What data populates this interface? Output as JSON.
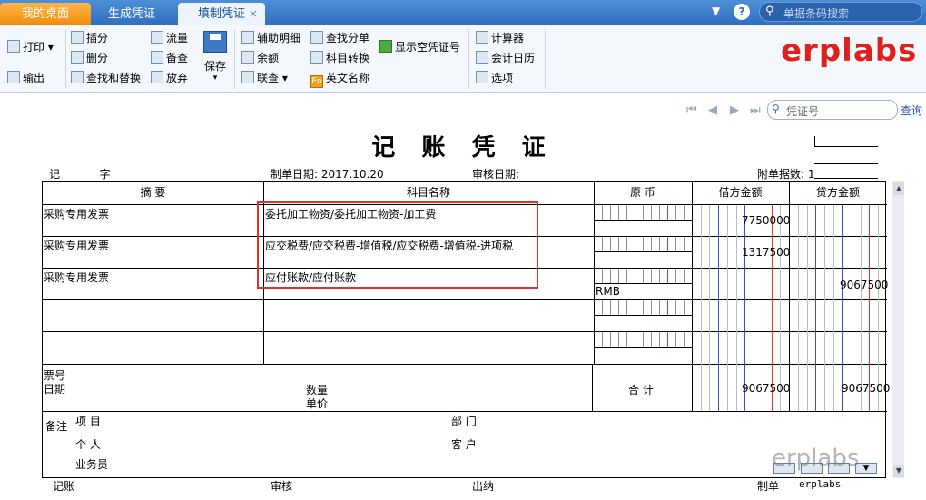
{
  "tabs": {
    "home": "我的桌面",
    "generate": "生成凭证",
    "fill": "填制凭证",
    "close": "×"
  },
  "top_search": {
    "placeholder": "单据条码搜索"
  },
  "brand": "erplabs",
  "ribbon": {
    "print": "打印",
    "output": "输出",
    "insert": "插分",
    "delete": "删分",
    "find_replace": "查找和替换",
    "flow": "流量",
    "backup": "备查",
    "discard": "放弃",
    "save": "保存",
    "aux_detail": "辅助明细",
    "balance": "余额",
    "linked_query": "联查",
    "find_entry": "查找分单",
    "account_convert": "科目转换",
    "english_name": "英文名称",
    "show_empty_no": "显示空凭证号",
    "calculator": "计算器",
    "calendar": "会计日历",
    "options": "选项"
  },
  "voucher_nav": {
    "search_placeholder": "凭证号",
    "query": "查询"
  },
  "voucher": {
    "title": "记 账 凭 证",
    "type_label": "记",
    "number_label": "字",
    "date_label": "制单日期:",
    "date": "2017.10.20",
    "audit_date_label": "审核日期:",
    "attachments_label": "附单据数:",
    "attachments": "1",
    "headers": {
      "summary": "摘 要",
      "account": "科目名称",
      "currency": "原 币",
      "debit": "借方金额",
      "credit": "贷方金额"
    },
    "rows": [
      {
        "summary": "采购专用发票",
        "account": "委托加工物资/委托加工物资-加工费",
        "currency": "",
        "debit": "7750000",
        "credit": ""
      },
      {
        "summary": "采购专用发票",
        "account": "应交税费/应交税费-增值税/应交税费-增值税-进项税",
        "currency": "",
        "debit": "1317500",
        "credit": ""
      },
      {
        "summary": "采购专用发票",
        "account": "应付账款/应付账款",
        "currency": "RMB",
        "debit": "",
        "credit": "9067500"
      },
      {
        "summary": "",
        "account": "",
        "currency": "",
        "debit": "",
        "credit": ""
      },
      {
        "summary": "",
        "account": "",
        "currency": "",
        "debit": "",
        "credit": ""
      }
    ],
    "bottom": {
      "ticket_no": "票号",
      "date": "日期",
      "quantity": "数量",
      "unit_price": "单价",
      "total_label": "合 计",
      "total_debit": "9067500",
      "total_credit": "9067500"
    },
    "remarks": {
      "label": "备注",
      "project": "项  目",
      "department": "部  门",
      "person": "个  人",
      "customer": "客  户",
      "salesman": "业务员"
    },
    "footer": {
      "bookkeeping": "记账",
      "audit": "审核",
      "cashier": "出纳",
      "maker_label": "制单",
      "maker": "erplabs"
    }
  },
  "watermark": "erplabs"
}
